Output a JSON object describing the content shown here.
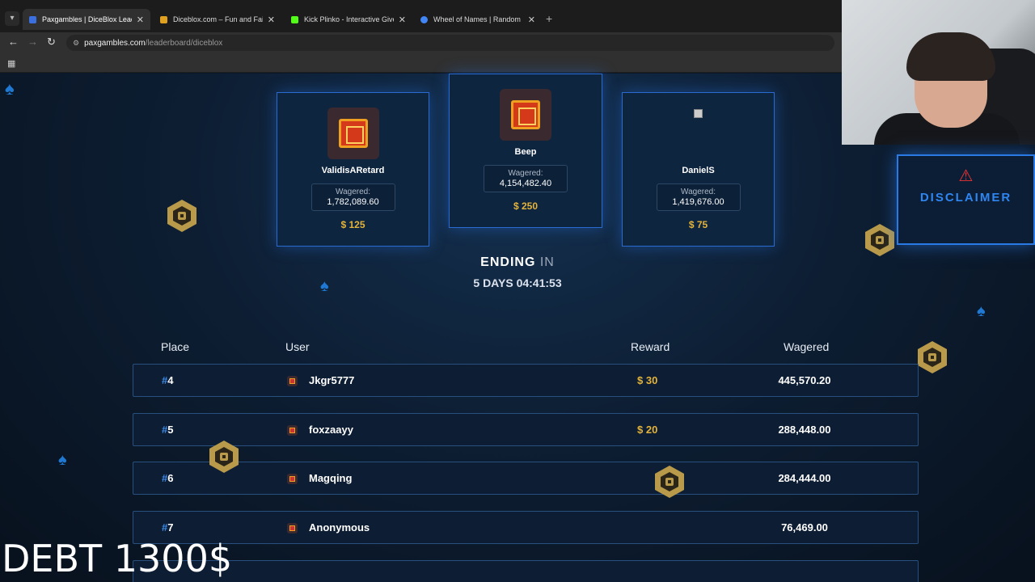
{
  "browser": {
    "tabs": [
      {
        "title": "Paxgambles | DiceBlox Leaderb",
        "favicon_color": "#3b6fe0",
        "active": true
      },
      {
        "title": "Diceblox.com – Fun and Fair Ga",
        "favicon_color": "#e0a020",
        "active": false
      },
      {
        "title": "Kick Plinko - Interactive Giveaw",
        "favicon_color": "#53fc18",
        "active": false
      },
      {
        "title": "Wheel of Names | Random nam",
        "favicon_color": "#4285f4",
        "active": false
      }
    ],
    "url_host": "paxgambles.com",
    "url_path": "/leaderboard/diceblox"
  },
  "podium": [
    {
      "rank": 2,
      "name": "ValidisARetard",
      "wagered_label": "Wagered:",
      "wagered": "1,782,089.60",
      "prize": "$ 125"
    },
    {
      "rank": 1,
      "name": "Beep",
      "wagered_label": "Wagered:",
      "wagered": "4,154,482.40",
      "prize": "$ 250"
    },
    {
      "rank": 3,
      "name": "DanielS",
      "wagered_label": "Wagered:",
      "wagered": "1,419,676.00",
      "prize": "$ 75"
    }
  ],
  "ending": {
    "label": "ENDING",
    "label_in": "IN",
    "countdown": "5 DAYS 04:41:53"
  },
  "table": {
    "headers": {
      "place": "Place",
      "user": "User",
      "reward": "Reward",
      "wagered": "Wagered"
    },
    "rows": [
      {
        "hash": "#",
        "place": "4",
        "user": "Jkgr5777",
        "reward": "$ 30",
        "wagered": "445,570.20"
      },
      {
        "hash": "#",
        "place": "5",
        "user": "foxzaayy",
        "reward": "$ 20",
        "wagered": "288,448.00"
      },
      {
        "hash": "#",
        "place": "6",
        "user": "Magqing",
        "reward": "",
        "wagered": "284,444.00"
      },
      {
        "hash": "#",
        "place": "7",
        "user": "Anonymous",
        "reward": "",
        "wagered": "76,469.00"
      }
    ]
  },
  "disclaimer": {
    "label": "DISCLAIMER",
    "icon": "warning-icon"
  },
  "overlay": {
    "debt_text": "DEBT 1300$"
  }
}
